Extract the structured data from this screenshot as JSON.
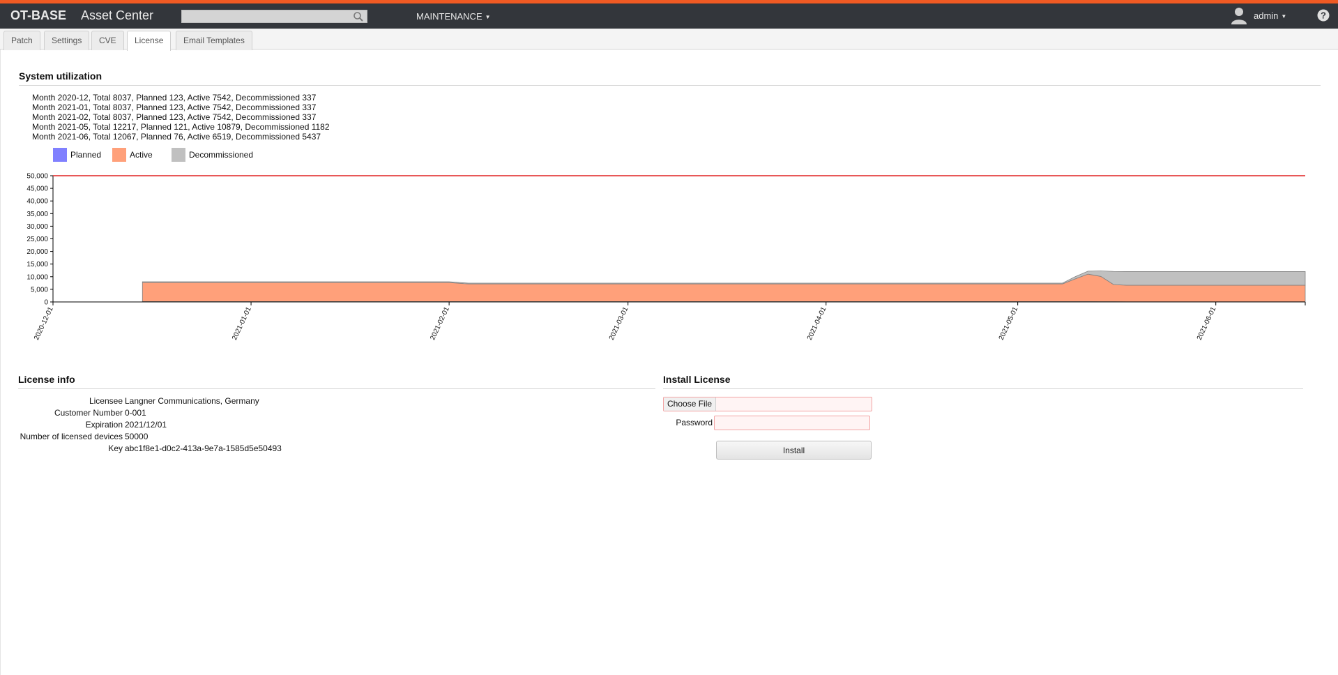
{
  "header": {
    "logo": "OT-BASE",
    "app_title": "Asset Center",
    "search_placeholder": "",
    "menu_label": "MAINTENANCE",
    "user_label": "admin"
  },
  "tabs": [
    {
      "label": "Patch",
      "active": false
    },
    {
      "label": "Settings",
      "active": false
    },
    {
      "label": "CVE",
      "active": false
    },
    {
      "label": "License",
      "active": true
    },
    {
      "label": "Email Templates",
      "active": false
    }
  ],
  "utilization": {
    "title": "System utilization",
    "lines": [
      "Month 2020-12, Total 8037, Planned 123, Active 7542, Decommissioned 337",
      "Month 2021-01, Total 8037, Planned 123, Active 7542, Decommissioned 337",
      "Month 2021-02, Total 8037, Planned 123, Active 7542, Decommissioned 337",
      "Month 2021-05, Total 12217, Planned 121, Active 10879, Decommissioned 1182",
      "Month 2021-06, Total 12067, Planned 76, Active 6519, Decommissioned 5437"
    ],
    "legend": [
      {
        "label": "Planned",
        "color": "#8080ff"
      },
      {
        "label": "Active",
        "color": "#ffa07a"
      },
      {
        "label": "Decommissioned",
        "color": "#c0c0c0"
      }
    ]
  },
  "chart_data": {
    "type": "area",
    "stacked": true,
    "limit_line": 50000,
    "limit_color": "#e02020",
    "ylim": [
      0,
      50000
    ],
    "yticks": [
      "0",
      "5,000",
      "10,000",
      "15,000",
      "20,000",
      "25,000",
      "30,000",
      "35,000",
      "40,000",
      "45,000",
      "50,000"
    ],
    "xlim": [
      "2020-12-01",
      "2021-06-15"
    ],
    "xticks": [
      "2020-12-01",
      "2021-01-01",
      "2021-02-01",
      "2021-03-01",
      "2021-04-01",
      "2021-05-01",
      "2021-06-01"
    ],
    "x": [
      "2020-12-15",
      "2021-02-01",
      "2021-02-04",
      "2021-05-08",
      "2021-05-10",
      "2021-05-12",
      "2021-05-14",
      "2021-05-16",
      "2021-05-18",
      "2021-06-15"
    ],
    "series": [
      {
        "name": "Planned",
        "color": "#8080ff",
        "values": [
          123,
          123,
          123,
          123,
          121,
          121,
          100,
          80,
          76,
          76
        ]
      },
      {
        "name": "Active",
        "color": "#ffa07a",
        "values": [
          7542,
          7542,
          7000,
          7000,
          9000,
          10879,
          10000,
          6800,
          6519,
          6519
        ]
      },
      {
        "name": "Decommissioned",
        "color": "#c0c0c0",
        "values": [
          337,
          337,
          337,
          337,
          900,
          1182,
          2200,
          5200,
          5437,
          5437
        ]
      }
    ]
  },
  "license_info": {
    "title": "License info",
    "rows": [
      {
        "label": "Licensee",
        "value": "Langner Communications, Germany"
      },
      {
        "label": "Customer Number",
        "value": "0-001"
      },
      {
        "label": "Expiration",
        "value": "2021/12/01"
      },
      {
        "label": "Number of licensed devices",
        "value": "50000"
      },
      {
        "label": "Key",
        "value": "abc1f8e1-d0c2-413a-9e7a-1585d5e50493"
      }
    ]
  },
  "install": {
    "title": "Install License",
    "choose_file": "Choose File",
    "password_label": "Password",
    "password_value": "",
    "install_label": "Install"
  }
}
